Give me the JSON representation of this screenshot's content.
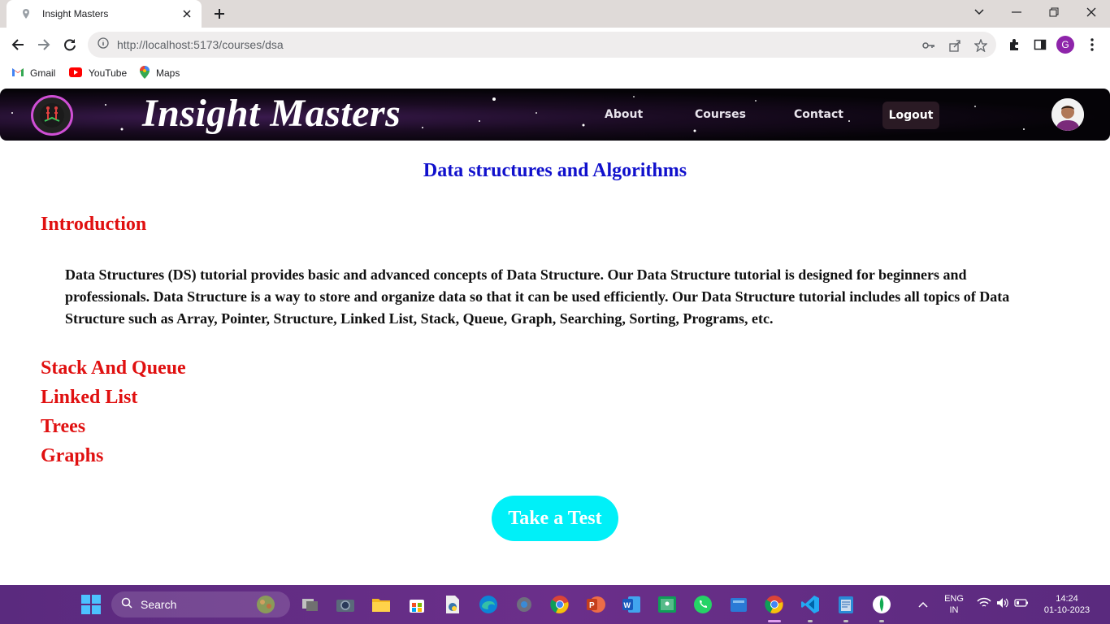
{
  "browser": {
    "tab_title": "Insight Masters",
    "url": "http://localhost:5173/courses/dsa",
    "profile_initial": "G",
    "bookmarks": [
      {
        "label": "Gmail",
        "icon": "gmail-icon"
      },
      {
        "label": "YouTube",
        "icon": "youtube-icon"
      },
      {
        "label": "Maps",
        "icon": "maps-icon"
      }
    ]
  },
  "header": {
    "brand": "Insight Masters",
    "nav": {
      "about": "About",
      "courses": "Courses",
      "contact": "Contact",
      "logout": "Logout"
    }
  },
  "main": {
    "title": "Data structures and Algorithms",
    "sections": {
      "introduction": "Introduction",
      "stack_queue": "Stack And Queue",
      "linked_list": "Linked List",
      "trees": "Trees",
      "graphs": "Graphs"
    },
    "intro_text": "Data Structures (DS) tutorial provides basic and advanced concepts of Data Structure. Our Data Structure tutorial is designed for beginners and professionals. Data Structure is a way to store and organize data so that it can be used efficiently. Our Data Structure tutorial includes all topics of Data Structure such as Array, Pointer, Structure, Linked List, Stack, Queue, Graph, Searching, Sorting, Programs, etc.",
    "test_button": "Take a Test"
  },
  "taskbar": {
    "search_label": "Search",
    "lang_line1": "ENG",
    "lang_line2": "IN",
    "time": "14:24",
    "date": "01-10-2023"
  },
  "colors": {
    "title_blue": "#1010cc",
    "section_red": "#e01010",
    "test_button": "#00f0f8",
    "taskbar": "#6b2f8a"
  }
}
